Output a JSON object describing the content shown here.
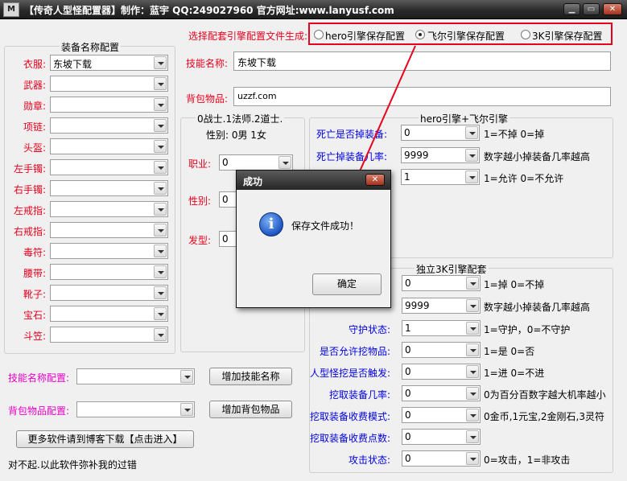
{
  "window": {
    "title": "【传奇人型怪配置器】制作：蓝宇 QQ:249027960 官方网址:www.lanyusf.com",
    "icon_text": "M"
  },
  "equip": {
    "group_title": "装备名称配置",
    "rows": [
      {
        "label": "衣服:",
        "value": "东坡下载"
      },
      {
        "label": "武器:",
        "value": ""
      },
      {
        "label": "勋章:",
        "value": ""
      },
      {
        "label": "项链:",
        "value": ""
      },
      {
        "label": "头盔:",
        "value": ""
      },
      {
        "label": "左手镯:",
        "value": ""
      },
      {
        "label": "右手镯:",
        "value": ""
      },
      {
        "label": "左戒指:",
        "value": ""
      },
      {
        "label": "右戒指:",
        "value": ""
      },
      {
        "label": "毒符:",
        "value": ""
      },
      {
        "label": "腰带:",
        "value": ""
      },
      {
        "label": "靴子:",
        "value": ""
      },
      {
        "label": "宝石:",
        "value": ""
      },
      {
        "label": "斗笠:",
        "value": ""
      }
    ]
  },
  "engine": {
    "label": "选择配套引擎配置文件生成:",
    "options": [
      {
        "label": "hero引擎保存配置",
        "selected": false
      },
      {
        "label": "飞尔引擎保存配置",
        "selected": true
      },
      {
        "label": "3K引擎保存配置",
        "selected": false
      }
    ]
  },
  "skill": {
    "label": "技能名称:",
    "value": "东坡下载"
  },
  "bag": {
    "label": "背包物品:",
    "value": "uzzf.com"
  },
  "middle": {
    "hint1": "0战士.1法师.2道士.",
    "hint2": "性别: 0男 1女",
    "job_label": "职业:",
    "job_value": "0",
    "sex_label": "性别:",
    "sex_value": "0",
    "hair_label": "发型:",
    "hair_value": "0"
  },
  "hero": {
    "title": "hero引擎+飞尔引擎",
    "rows": [
      {
        "label": "死亡是否掉装备:",
        "value": "0",
        "hint": "1=不掉 0=掉"
      },
      {
        "label": "死亡掉装备几率:",
        "value": "9999",
        "hint": "数字越小掉装备几率越高"
      },
      {
        "label": "",
        "value": "1",
        "hint": "1=允许 0=不允许"
      }
    ]
  },
  "k3": {
    "title": "独立3K引擎配套",
    "rows": [
      {
        "label": "",
        "value": "0",
        "hint": "1=掉 0=不掉"
      },
      {
        "label": "",
        "value": "9999",
        "hint": "数字越小掉装备几率越高"
      },
      {
        "label": "守护状态:",
        "value": "1",
        "hint": "1=守护，0=不守护"
      },
      {
        "label": "是否允许挖物品:",
        "value": "0",
        "hint": "1=是 0=否"
      },
      {
        "label": "人型怪挖是否触发:",
        "value": "0",
        "hint": "1=进  0=不进"
      },
      {
        "label": "挖取装备几率:",
        "value": "0",
        "hint": "0为百分百数字越大机率越小"
      },
      {
        "label": "挖取装备收费模式:",
        "value": "0",
        "hint": "0金币,1元宝,2金刚石,3灵符"
      },
      {
        "label": "挖取装备收费点数:",
        "value": "0",
        "hint": ""
      },
      {
        "label": "攻击状态:",
        "value": "0",
        "hint": "0=攻击，1=非攻击"
      }
    ]
  },
  "bottom": {
    "skill_cfg_label": "技能名称配置:",
    "skill_cfg_value": "",
    "add_skill": "增加技能名称",
    "bag_cfg_label": "背包物品配置:",
    "bag_cfg_value": "",
    "add_bag": "增加背包物品",
    "more_btn": "更多软件请到博客下载【点击进入】",
    "footer": "对不起.以此软件弥补我的过错"
  },
  "dialog": {
    "title": "成功",
    "message": "保存文件成功！",
    "ok": "确定"
  },
  "colors": {
    "label_red": "#e8001c",
    "label_blue": "#0000e0",
    "label_magenta": "#e800c8",
    "annotation": "#e8001c"
  }
}
